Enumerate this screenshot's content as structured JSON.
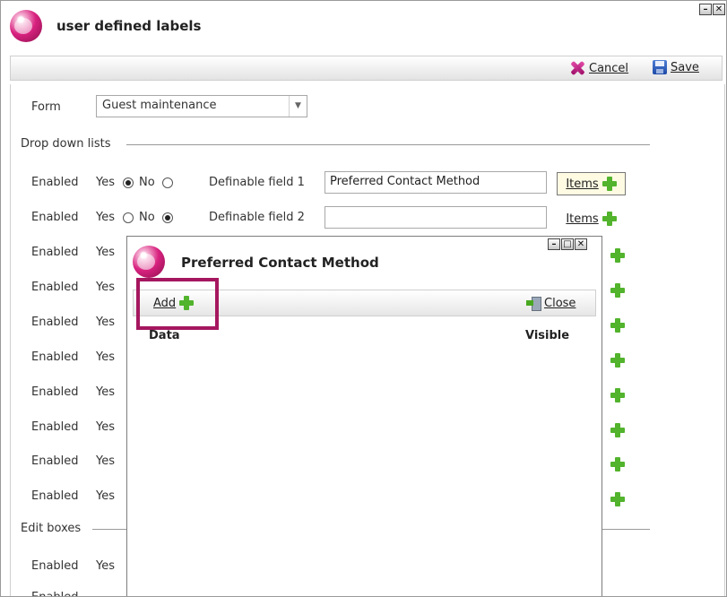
{
  "window": {
    "title": "user defined labels",
    "min": "–",
    "close": "✕"
  },
  "toolbar": {
    "cancel_label": "Cancel",
    "save_label": "Save"
  },
  "form": {
    "label": "Form",
    "value": "Guest maintenance"
  },
  "sections": {
    "drop_down": "Drop down lists",
    "edit_boxes": "Edit boxes"
  },
  "common": {
    "enabled": "Enabled",
    "yes": "Yes",
    "no": "No",
    "items": "Items"
  },
  "rows": [
    {
      "field_label": "Definable field 1",
      "value": "Preferred Contact Method",
      "enabled": true
    },
    {
      "field_label": "Definable field 2",
      "value": "",
      "enabled": false
    }
  ],
  "dialog": {
    "title": "Preferred Contact Method",
    "add_label": "Add",
    "close_label": "Close",
    "columns": [
      "Data",
      "Visible"
    ]
  }
}
